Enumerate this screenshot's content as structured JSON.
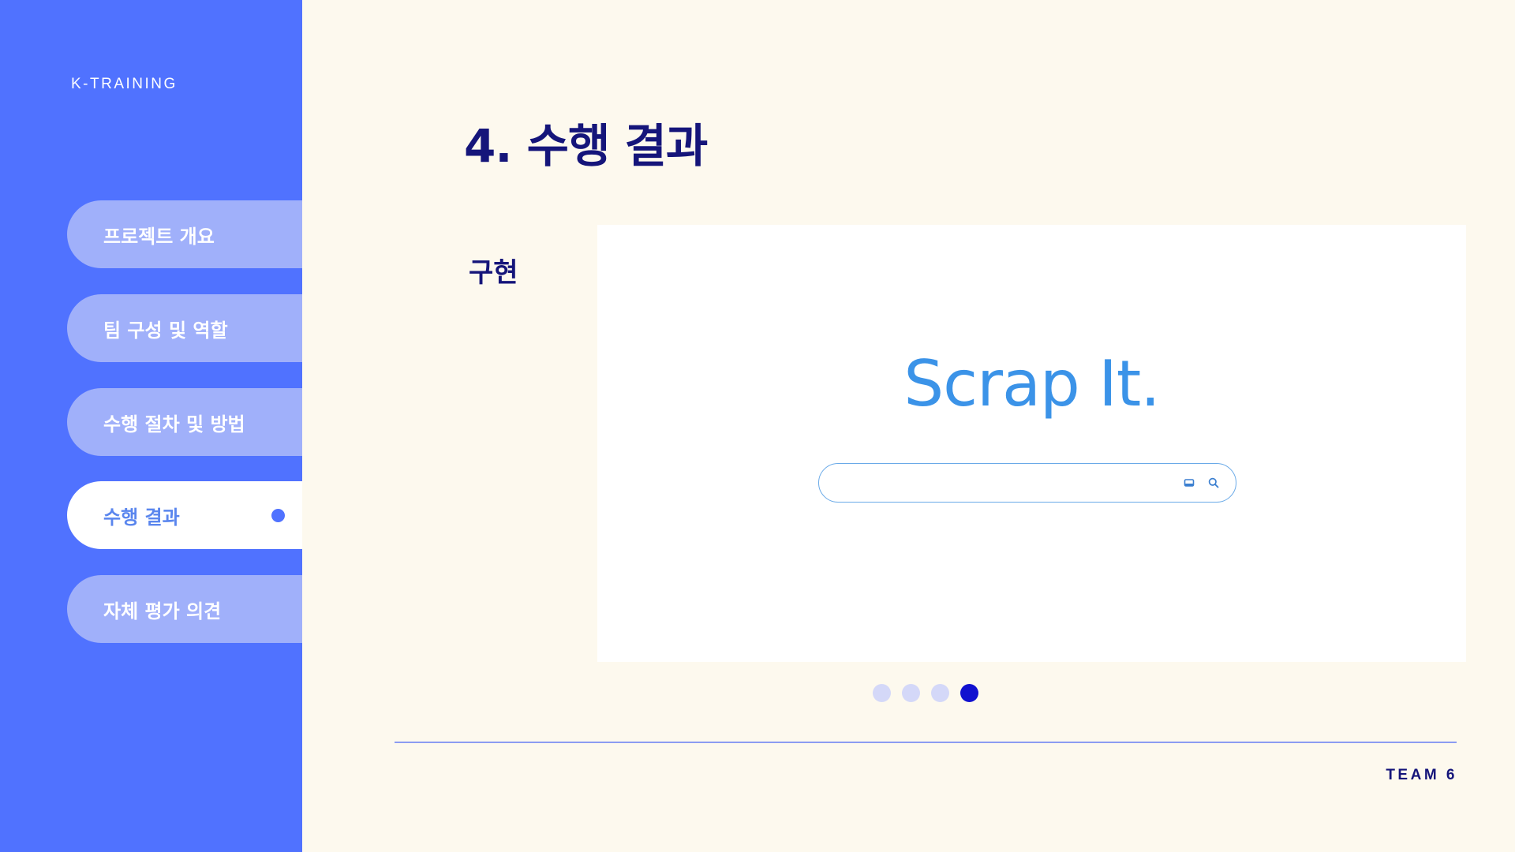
{
  "brand": "K-TRAINING",
  "nav": [
    {
      "label": "프로젝트 개요"
    },
    {
      "label": "팀 구성 및 역할"
    },
    {
      "label": "수행 절차 및 방법"
    },
    {
      "label": "수행 결과",
      "active": true
    },
    {
      "label": "자체 평가 의견"
    }
  ],
  "page_title": "4. 수행 결과",
  "section_label": "구현",
  "preview": {
    "logo": "Scrap It.",
    "search_value": "",
    "search_icon": "search-icon",
    "keyboard_icon": "keyboard-icon",
    "accent_color": "#3B93E8"
  },
  "pagination": {
    "total": 4,
    "current": 4
  },
  "footer": "TEAM 6",
  "colors": {
    "sidebar": "#5072FF",
    "background": "#FDF9EE",
    "title": "#15157A",
    "nav_inactive": "#A0B0FA",
    "nav_active_text": "#5A86EE"
  }
}
